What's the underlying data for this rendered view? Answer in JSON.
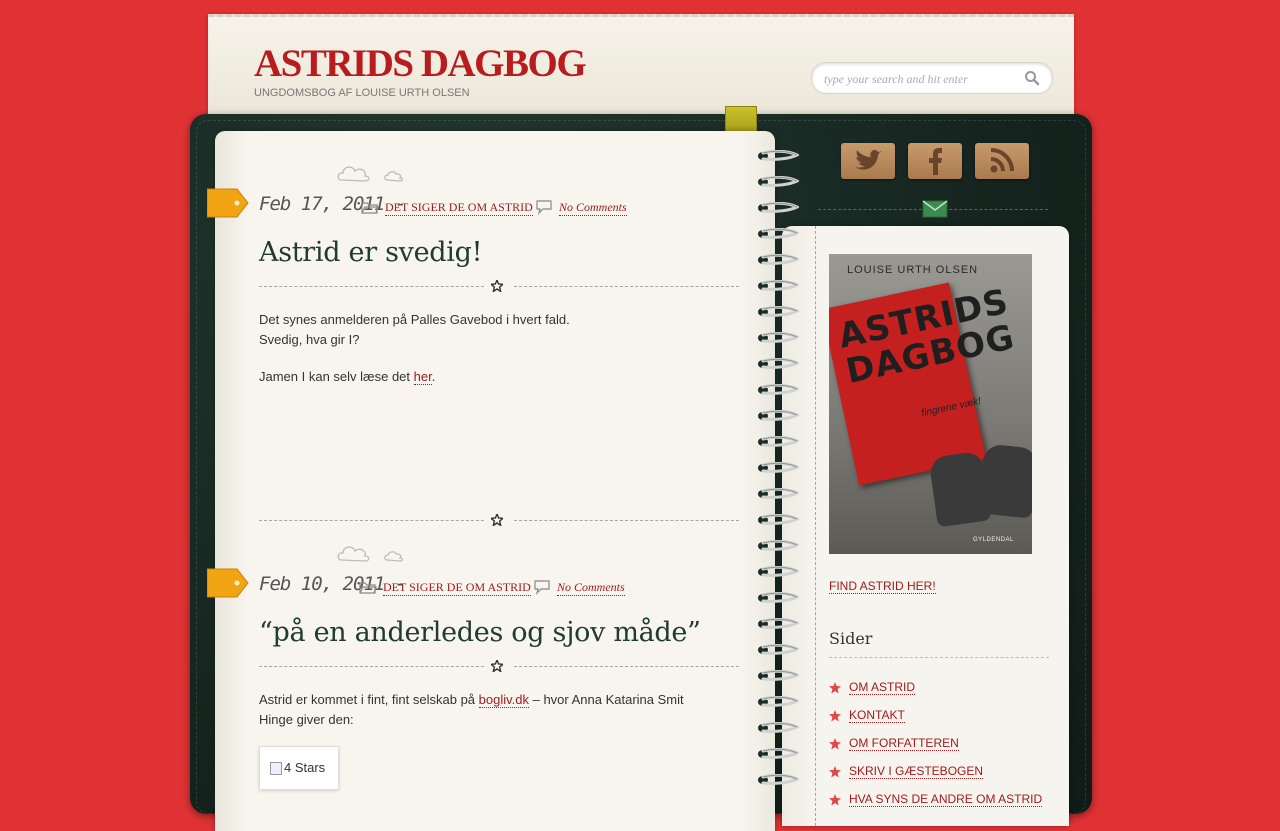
{
  "site": {
    "title": "ASTRIDS DAGBOG",
    "tagline": "UNGDOMSBOG AF LOUISE URTH OLSEN",
    "search_placeholder": "type your search and hit enter"
  },
  "posts": [
    {
      "date": "Feb 17, 2011 -",
      "category": "DET SIGER DE OM ASTRID",
      "comments": "No Comments",
      "title": "Astrid er svedig!",
      "body": {
        "line1": "Det synes anmelderen på Palles Gavebod i hvert fald.",
        "line2": "Svedig, hva gir I?",
        "line3_before": "Jamen I kan selv læse det ",
        "line3_link": "her",
        "line3_after": "."
      }
    },
    {
      "date": "Feb 10, 2011 -",
      "category": "DET SIGER DE OM ASTRID",
      "comments": "No Comments",
      "title": "“på en anderledes og sjov måde”",
      "body": {
        "before": "Astrid er kommet i fint, fint selskab på ",
        "link": "bogliv.dk",
        "after": " – hvor Anna Katarina Smit Hinge giver den:"
      },
      "rating_alt": "4 Stars"
    }
  ],
  "sidebar": {
    "social_icons": [
      "twitter-icon",
      "facebook-icon",
      "rss-icon"
    ],
    "book_cover": {
      "author": "LOUISE URTH OLSEN",
      "title_line1": "ASTRIDS",
      "title_line2": "DAGBOG",
      "subtitle": "fingrene væk!",
      "publisher": "GYLDENDAL"
    },
    "find_link": "FIND ASTRID HER!",
    "pages_heading": "Sider",
    "pages": [
      "OM ASTRID",
      "KONTAKT",
      "OM FORFATTEREN",
      "SKRIV I GÆSTEBOGEN",
      "HVA SYNS DE ANDRE OM ASTRID"
    ]
  },
  "colors": {
    "background": "#e03234",
    "title_red": "#b81c1e",
    "link_red": "#a31b1d",
    "post_title_green": "#203b32",
    "cover_dark_green": "#16251f"
  }
}
